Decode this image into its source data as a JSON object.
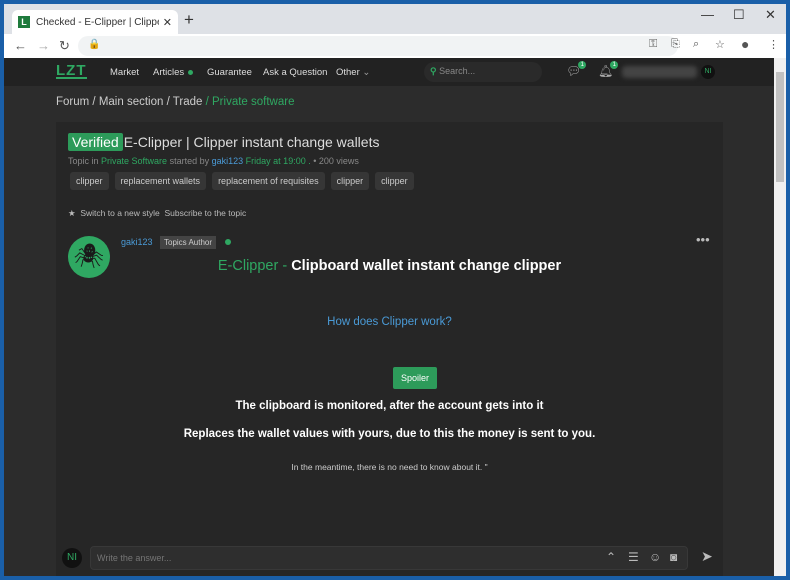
{
  "browser": {
    "tab_title": "Checked - E-Clipper | Clipper inst",
    "favicon": "L"
  },
  "nav": {
    "logo": "LZT",
    "items": [
      "Market",
      "Articles",
      "Guarantee",
      "Ask a Question",
      "Other"
    ],
    "search_placeholder": "Search...",
    "messages_count": "1",
    "alerts_count": "1",
    "avatar": "NI"
  },
  "breadcrumb": [
    "Forum",
    "Main section",
    "Trade",
    "Private software"
  ],
  "topic": {
    "badge": "Verified",
    "title": "E-Clipper | Clipper instant change wallets",
    "meta_prefix": "Topic in",
    "section": "Private Software",
    "started_by": "started by",
    "author": "gaki123",
    "time": "Friday at 19:00 .",
    "views": "• 200 views",
    "tags": [
      "clipper",
      "replacement wallets",
      "replacement of requisites",
      "clipper",
      "clipper"
    ],
    "switch_style": "Switch to a new style",
    "subscribe": "Subscribe to the topic"
  },
  "post": {
    "author": "gaki123",
    "role": "Topics Author",
    "heading_accent": "E-Clipper -",
    "heading": "Clipboard wallet instant change clipper",
    "link": "How does Clipper work?",
    "spoiler": "Spoiler",
    "line1": "The clipboard is monitored, after the account gets into it",
    "line2": "Replaces the wallet values with yours, due to this the money is sent to you.",
    "line3": "In the meantime, there is no need to know about it. \""
  },
  "reply": {
    "avatar": "NI",
    "placeholder": "Write the answer..."
  },
  "colors": {
    "accent": "#2fa862",
    "link": "#4a9ad6"
  }
}
